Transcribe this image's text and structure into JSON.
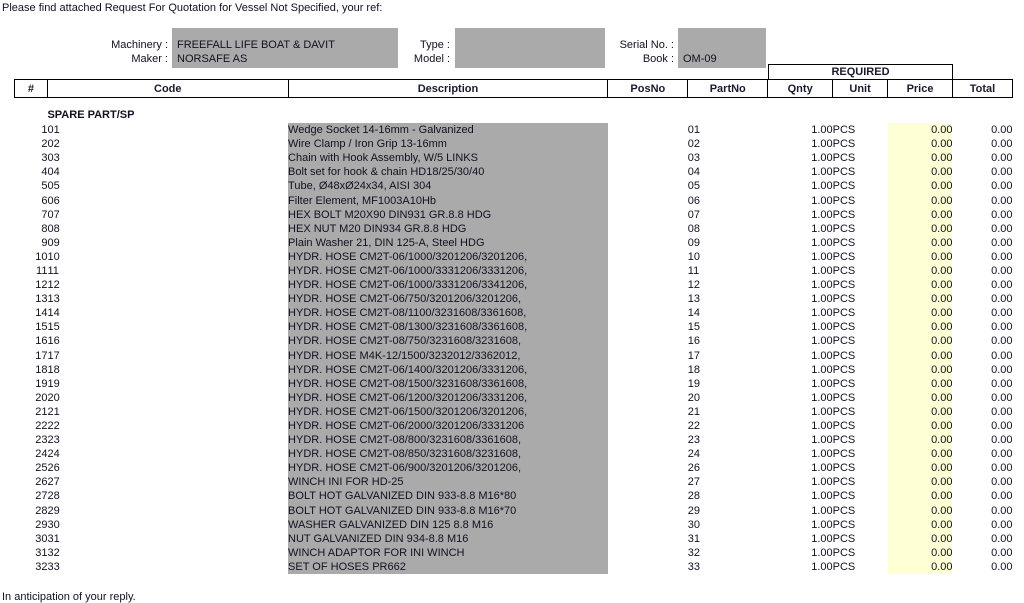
{
  "document": {
    "intro_text": "Please find attached Request For Quotation for Vessel Not Specified, your ref:",
    "outro_text": "In anticipation of your reply.",
    "field_fill_color": "#aaaaaa",
    "price_cell_color": "#feffd4"
  },
  "header_fields": {
    "machinery_label": "Machinery :",
    "machinery_value": "FREEFALL LIFE BOAT & DAVIT",
    "maker_label": "Maker :",
    "maker_value": "NORSAFE AS",
    "type_label": "Type :",
    "type_value": "",
    "model_label": "Model :",
    "model_value": "",
    "serial_label": "Serial No. :",
    "serial_value": "",
    "book_label": "Book :",
    "book_value": "OM-09"
  },
  "table": {
    "group_header": "REQUIRED",
    "columns": [
      "#",
      "Code",
      "Description",
      "PosNo",
      "PartNo",
      "Qnty",
      "Unit",
      "Price",
      "Total"
    ],
    "section_label": "SPARE PART/SP",
    "rows": [
      {
        "num": "1",
        "code": "01",
        "desc": "Wedge Socket 14-16mm - Galvanized",
        "pos": "",
        "part": "01",
        "qnty": "1.00",
        "unit": "PCS",
        "price": "0.00",
        "total": "0.00"
      },
      {
        "num": "2",
        "code": "02",
        "desc": "Wire Clamp / Iron Grip 13-16mm",
        "pos": "",
        "part": "02",
        "qnty": "1.00",
        "unit": "PCS",
        "price": "0.00",
        "total": "0.00"
      },
      {
        "num": "3",
        "code": "03",
        "desc": "Chain with Hook Assembly, W/5 LINKS",
        "pos": "",
        "part": "03",
        "qnty": "1.00",
        "unit": "PCS",
        "price": "0.00",
        "total": "0.00"
      },
      {
        "num": "4",
        "code": "04",
        "desc": "Bolt set for hook & chain HD18/25/30/40",
        "pos": "",
        "part": "04",
        "qnty": "1.00",
        "unit": "PCS",
        "price": "0.00",
        "total": "0.00"
      },
      {
        "num": "5",
        "code": "05",
        "desc": "Tube, Ø48xØ24x34, AISI 304",
        "pos": "",
        "part": "05",
        "qnty": "1.00",
        "unit": "PCS",
        "price": "0.00",
        "total": "0.00"
      },
      {
        "num": "6",
        "code": "06",
        "desc": "Filter Element, MF1003A10Hb",
        "pos": "",
        "part": "06",
        "qnty": "1.00",
        "unit": "PCS",
        "price": "0.00",
        "total": "0.00"
      },
      {
        "num": "7",
        "code": "07",
        "desc": "HEX BOLT M20X90 DIN931 GR.8.8 HDG",
        "pos": "",
        "part": "07",
        "qnty": "1.00",
        "unit": "PCS",
        "price": "0.00",
        "total": "0.00"
      },
      {
        "num": "8",
        "code": "08",
        "desc": "HEX NUT M20 DIN934 GR.8.8 HDG",
        "pos": "",
        "part": "08",
        "qnty": "1.00",
        "unit": "PCS",
        "price": "0.00",
        "total": "0.00"
      },
      {
        "num": "9",
        "code": "09",
        "desc": "Plain Washer 21, DIN 125-A, Steel HDG",
        "pos": "",
        "part": "09",
        "qnty": "1.00",
        "unit": "PCS",
        "price": "0.00",
        "total": "0.00"
      },
      {
        "num": "10",
        "code": "10",
        "desc": "HYDR. HOSE CM2T-06/1000/3201206/3201206,",
        "pos": "",
        "part": "10",
        "qnty": "1.00",
        "unit": "PCS",
        "price": "0.00",
        "total": "0.00"
      },
      {
        "num": "11",
        "code": "11",
        "desc": "HYDR. HOSE CM2T-06/1000/3331206/3331206,",
        "pos": "",
        "part": "11",
        "qnty": "1.00",
        "unit": "PCS",
        "price": "0.00",
        "total": "0.00"
      },
      {
        "num": "12",
        "code": "12",
        "desc": "HYDR. HOSE CM2T-06/1000/3331206/3341206,",
        "pos": "",
        "part": "12",
        "qnty": "1.00",
        "unit": "PCS",
        "price": "0.00",
        "total": "0.00"
      },
      {
        "num": "13",
        "code": "13",
        "desc": "HYDR. HOSE CM2T-06/750/3201206/3201206,",
        "pos": "",
        "part": "13",
        "qnty": "1.00",
        "unit": "PCS",
        "price": "0.00",
        "total": "0.00"
      },
      {
        "num": "14",
        "code": "14",
        "desc": "HYDR. HOSE CM2T-08/1100/3231608/3361608,",
        "pos": "",
        "part": "14",
        "qnty": "1.00",
        "unit": "PCS",
        "price": "0.00",
        "total": "0.00"
      },
      {
        "num": "15",
        "code": "15",
        "desc": "HYDR. HOSE CM2T-08/1300/3231608/3361608,",
        "pos": "",
        "part": "15",
        "qnty": "1.00",
        "unit": "PCS",
        "price": "0.00",
        "total": "0.00"
      },
      {
        "num": "16",
        "code": "16",
        "desc": "HYDR. HOSE CM2T-08/750/3231608/3231608,",
        "pos": "",
        "part": "16",
        "qnty": "1.00",
        "unit": "PCS",
        "price": "0.00",
        "total": "0.00"
      },
      {
        "num": "17",
        "code": "17",
        "desc": "HYDR. HOSE M4K-12/1500/3232012/3362012,",
        "pos": "",
        "part": "17",
        "qnty": "1.00",
        "unit": "PCS",
        "price": "0.00",
        "total": "0.00"
      },
      {
        "num": "18",
        "code": "18",
        "desc": "HYDR. HOSE CM2T-06/1400/3201206/3331206,",
        "pos": "",
        "part": "18",
        "qnty": "1.00",
        "unit": "PCS",
        "price": "0.00",
        "total": "0.00"
      },
      {
        "num": "19",
        "code": "19",
        "desc": "HYDR. HOSE CM2T-08/1500/3231608/3361608,",
        "pos": "",
        "part": "19",
        "qnty": "1.00",
        "unit": "PCS",
        "price": "0.00",
        "total": "0.00"
      },
      {
        "num": "20",
        "code": "20",
        "desc": "HYDR. HOSE CM2T-06/1200/3201206/3331206,",
        "pos": "",
        "part": "20",
        "qnty": "1.00",
        "unit": "PCS",
        "price": "0.00",
        "total": "0.00"
      },
      {
        "num": "21",
        "code": "21",
        "desc": "HYDR. HOSE CM2T-06/1500/3201206/3201206,",
        "pos": "",
        "part": "21",
        "qnty": "1.00",
        "unit": "PCS",
        "price": "0.00",
        "total": "0.00"
      },
      {
        "num": "22",
        "code": "22",
        "desc": "HYDR. HOSE CM2T-06/2000/3201206/3331206",
        "pos": "",
        "part": "22",
        "qnty": "1.00",
        "unit": "PCS",
        "price": "0.00",
        "total": "0.00"
      },
      {
        "num": "23",
        "code": "23",
        "desc": "HYDR. HOSE CM2T-08/800/3231608/3361608,",
        "pos": "",
        "part": "23",
        "qnty": "1.00",
        "unit": "PCS",
        "price": "0.00",
        "total": "0.00"
      },
      {
        "num": "24",
        "code": "24",
        "desc": "HYDR. HOSE CM2T-08/850/3231608/3231608,",
        "pos": "",
        "part": "24",
        "qnty": "1.00",
        "unit": "PCS",
        "price": "0.00",
        "total": "0.00"
      },
      {
        "num": "25",
        "code": "26",
        "desc": "HYDR. HOSE CM2T-06/900/3201206/3201206,",
        "pos": "",
        "part": "26",
        "qnty": "1.00",
        "unit": "PCS",
        "price": "0.00",
        "total": "0.00"
      },
      {
        "num": "26",
        "code": "27",
        "desc": "WINCH INI FOR HD-25",
        "pos": "",
        "part": "27",
        "qnty": "1.00",
        "unit": "PCS",
        "price": "0.00",
        "total": "0.00"
      },
      {
        "num": "27",
        "code": "28",
        "desc": "BOLT HOT GALVANIZED DIN 933-8.8 M16*80",
        "pos": "",
        "part": "28",
        "qnty": "1.00",
        "unit": "PCS",
        "price": "0.00",
        "total": "0.00"
      },
      {
        "num": "28",
        "code": "29",
        "desc": "BOLT HOT GALVANIZED DIN 933-8.8 M16*70",
        "pos": "",
        "part": "29",
        "qnty": "1.00",
        "unit": "PCS",
        "price": "0.00",
        "total": "0.00"
      },
      {
        "num": "29",
        "code": "30",
        "desc": "WASHER GALVANIZED DIN 125 8.8 M16",
        "pos": "",
        "part": "30",
        "qnty": "1.00",
        "unit": "PCS",
        "price": "0.00",
        "total": "0.00"
      },
      {
        "num": "30",
        "code": "31",
        "desc": "NUT GALVANIZED DIN 934-8.8 M16",
        "pos": "",
        "part": "31",
        "qnty": "1.00",
        "unit": "PCS",
        "price": "0.00",
        "total": "0.00"
      },
      {
        "num": "31",
        "code": "32",
        "desc": "WINCH ADAPTOR FOR INI WINCH",
        "pos": "",
        "part": "32",
        "qnty": "1.00",
        "unit": "PCS",
        "price": "0.00",
        "total": "0.00"
      },
      {
        "num": "32",
        "code": "33",
        "desc": "SET OF HOSES PR662",
        "pos": "",
        "part": "33",
        "qnty": "1.00",
        "unit": "PCS",
        "price": "0.00",
        "total": "0.00"
      }
    ]
  }
}
